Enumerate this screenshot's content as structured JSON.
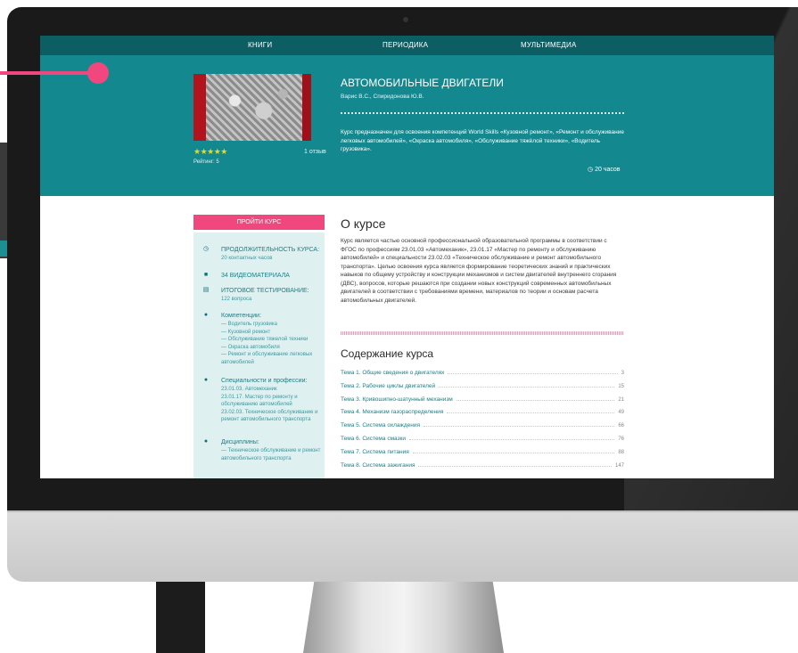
{
  "nav": {
    "items": [
      "КНИГИ",
      "ПЕРИОДИКА",
      "МУЛЬТИМЕДИА"
    ]
  },
  "course": {
    "title": "АВТОМОБИЛЬНЫЕ ДВИГАТЕЛИ",
    "authors": "Варис В.С., Спиридонова Ю.В.",
    "stars": "★★★★★",
    "rating": "Рейтинг: 5",
    "reviews": "1 отзыв",
    "description": "Курс предназначен для освоения компетенций World Skills «Кузовной ремонт», «Ремонт и обслуживание легковых автомобилей», «Окраска автомобиля», «Обслуживание тяжёлой техники», «Водитель грузовика».",
    "hours": "20 часов"
  },
  "sidebar": {
    "button": "ПРОЙТИ КУРС",
    "duration_head": "ПРОДОЛЖИТЕЛЬНОСТЬ КУРСА:",
    "duration_value": "20 контактных часов",
    "videos": "34 ВИДЕОМАТЕРИАЛА",
    "test_head": "ИТОГОВОЕ ТЕСТИРОВАНИЕ:",
    "test_value": "122 вопроса",
    "competencies_head": "Компетенции:",
    "competencies": "— Водитель грузовика\n— Кузовной ремонт\n— Обслуживание тяжелой техники\n— Окраска автомобиля\n— Ремонт и обслуживание легковых автомобилей",
    "specialties_head": "Специальности и профессии:",
    "specialties": "23.01.03. Автомеханик\n23.01.17. Мастер по ремонту и обслуживанию автомобилей\n23.02.03. Техническое обслуживание и ремонт автомобильного транспорта",
    "disciplines_head": "Дисциплины:",
    "disciplines": "— Техническое обслуживание и ремонт автомобильного транспорта"
  },
  "about": {
    "title": "О курсе",
    "text": "Курс является частью основной профессиональной образовательной программы в соответствии с ФГОС по профессиям 23.01.03 «Автомеханик», 23.01.17 «Мастер по ремонту и обслуживанию автомобилей» и специальности 23.02.03 «Техническое обслуживание и ремонт автомобильного транспорта». Целью освоения курса является формирование теоретических знаний и практических навыков по общему устройству и конструкции механизмов и систем двигателей внутреннего сгорания (ДВС), вопросов, которые решаются при создании новых конструкций современных автомобильных двигателей в соответствии с требованиями времени, материалов по теории и основам расчета автомобильных двигателей."
  },
  "toc": {
    "title": "Содержание курса",
    "rows": [
      {
        "label": "Тема 1. Общие сведения о двигателях",
        "page": "3"
      },
      {
        "label": "Тема 2. Рабочие циклы двигателей",
        "page": "15"
      },
      {
        "label": "Тема 3. Кривошипно-шатунный механизм",
        "page": "21"
      },
      {
        "label": "Тема 4. Механизм газораспределения",
        "page": "49"
      },
      {
        "label": "Тема 5. Система охлаждения",
        "page": "66"
      },
      {
        "label": "Тема 6. Система смазки",
        "page": "76"
      },
      {
        "label": "Тема 7. Система питания",
        "page": "88"
      },
      {
        "label": "Тема 8. Система зажигания",
        "page": "147"
      }
    ]
  },
  "colors": {
    "nav": "#0c5e63",
    "hero": "#14888f",
    "accent": "#f0477f",
    "sidebar": "#dff0f1"
  }
}
